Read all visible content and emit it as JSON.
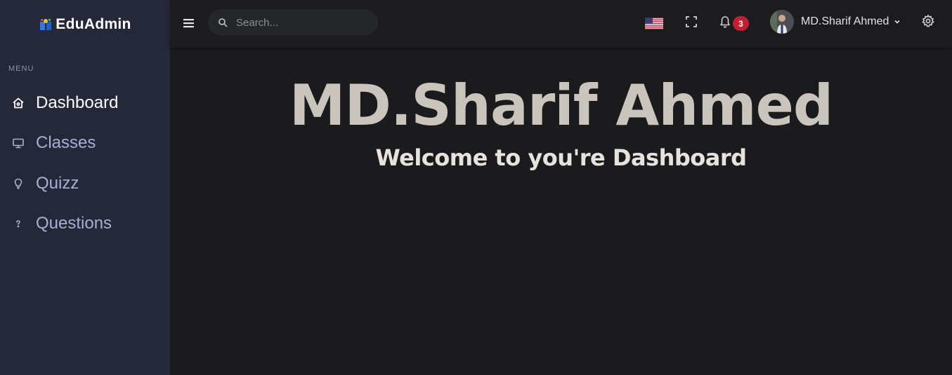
{
  "brand": {
    "name": "EduAdmin",
    "logo_icon": "edu-logo-icon"
  },
  "sidebar": {
    "menu_title": "MENU",
    "items": [
      {
        "label": "Dashboard",
        "icon": "home-icon",
        "active": true
      },
      {
        "label": "Classes",
        "icon": "monitor-icon",
        "active": false
      },
      {
        "label": "Quizz",
        "icon": "lightbulb-icon",
        "active": false
      },
      {
        "label": "Questions",
        "icon": "question-icon",
        "active": false
      }
    ]
  },
  "topbar": {
    "menu_icon": "hamburger-icon",
    "search": {
      "placeholder": "Search...",
      "value": ""
    },
    "language_icon": "us-flag-icon",
    "fullscreen_icon": "fullscreen-icon",
    "notifications": {
      "icon": "bell-icon",
      "count": "3"
    },
    "user": {
      "name": "MD.Sharif Ahmed",
      "avatar": "avatar"
    },
    "settings_icon": "gear-icon"
  },
  "main": {
    "title": "MD.Sharif Ahmed",
    "subtitle": "Welcome to you're Dashboard"
  },
  "colors": {
    "sidebar_bg": "#252839",
    "topbar_bg": "#1c1c1e",
    "page_bg": "#1b1b1d",
    "badge": "#c41e34",
    "nav_text": "#a6b0cf"
  }
}
